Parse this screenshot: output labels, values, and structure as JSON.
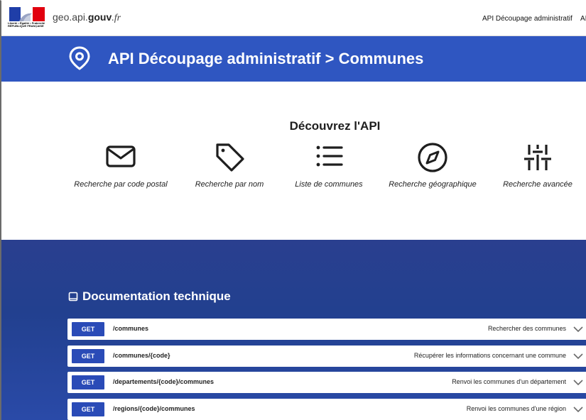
{
  "header": {
    "logo_lines": "Liberté • Égalité • Fraternité RÉPUBLIQUE FRANÇAISE",
    "site_prefix": "geo.api.",
    "site_bold": "gouv",
    "site_suffix": ".fr",
    "nav_link": "API Découpage administratif",
    "nav_link_truncated": "AI"
  },
  "banner": {
    "icon": "location-pin-icon",
    "title": "API Découpage administratif > Communes"
  },
  "discover": {
    "title": "Découvrez l'API",
    "features": [
      {
        "icon": "envelope-icon",
        "label": "Recherche par code postal"
      },
      {
        "icon": "tag-icon",
        "label": "Recherche par nom"
      },
      {
        "icon": "list-icon",
        "label": "Liste de communes"
      },
      {
        "icon": "compass-icon",
        "label": "Recherche géographique"
      },
      {
        "icon": "sliders-icon",
        "label": "Recherche avancée"
      }
    ]
  },
  "docs": {
    "icon": "book-icon",
    "title": "Documentation technique",
    "endpoints": [
      {
        "method": "GET",
        "path": "/communes",
        "summary": "Rechercher des communes"
      },
      {
        "method": "GET",
        "path": "/communes/{code}",
        "summary": "Récupérer les informations concernant une commune"
      },
      {
        "method": "GET",
        "path": "/departements/{code}/communes",
        "summary": "Renvoi les communes d'un département"
      },
      {
        "method": "GET",
        "path": "/regions/{code}/communes",
        "summary": "Renvoi les communes d'une région"
      }
    ]
  },
  "colors": {
    "brand_blue": "#2f56c1",
    "doc_blue": "#22408f",
    "get_badge": "#2a4bb7"
  }
}
